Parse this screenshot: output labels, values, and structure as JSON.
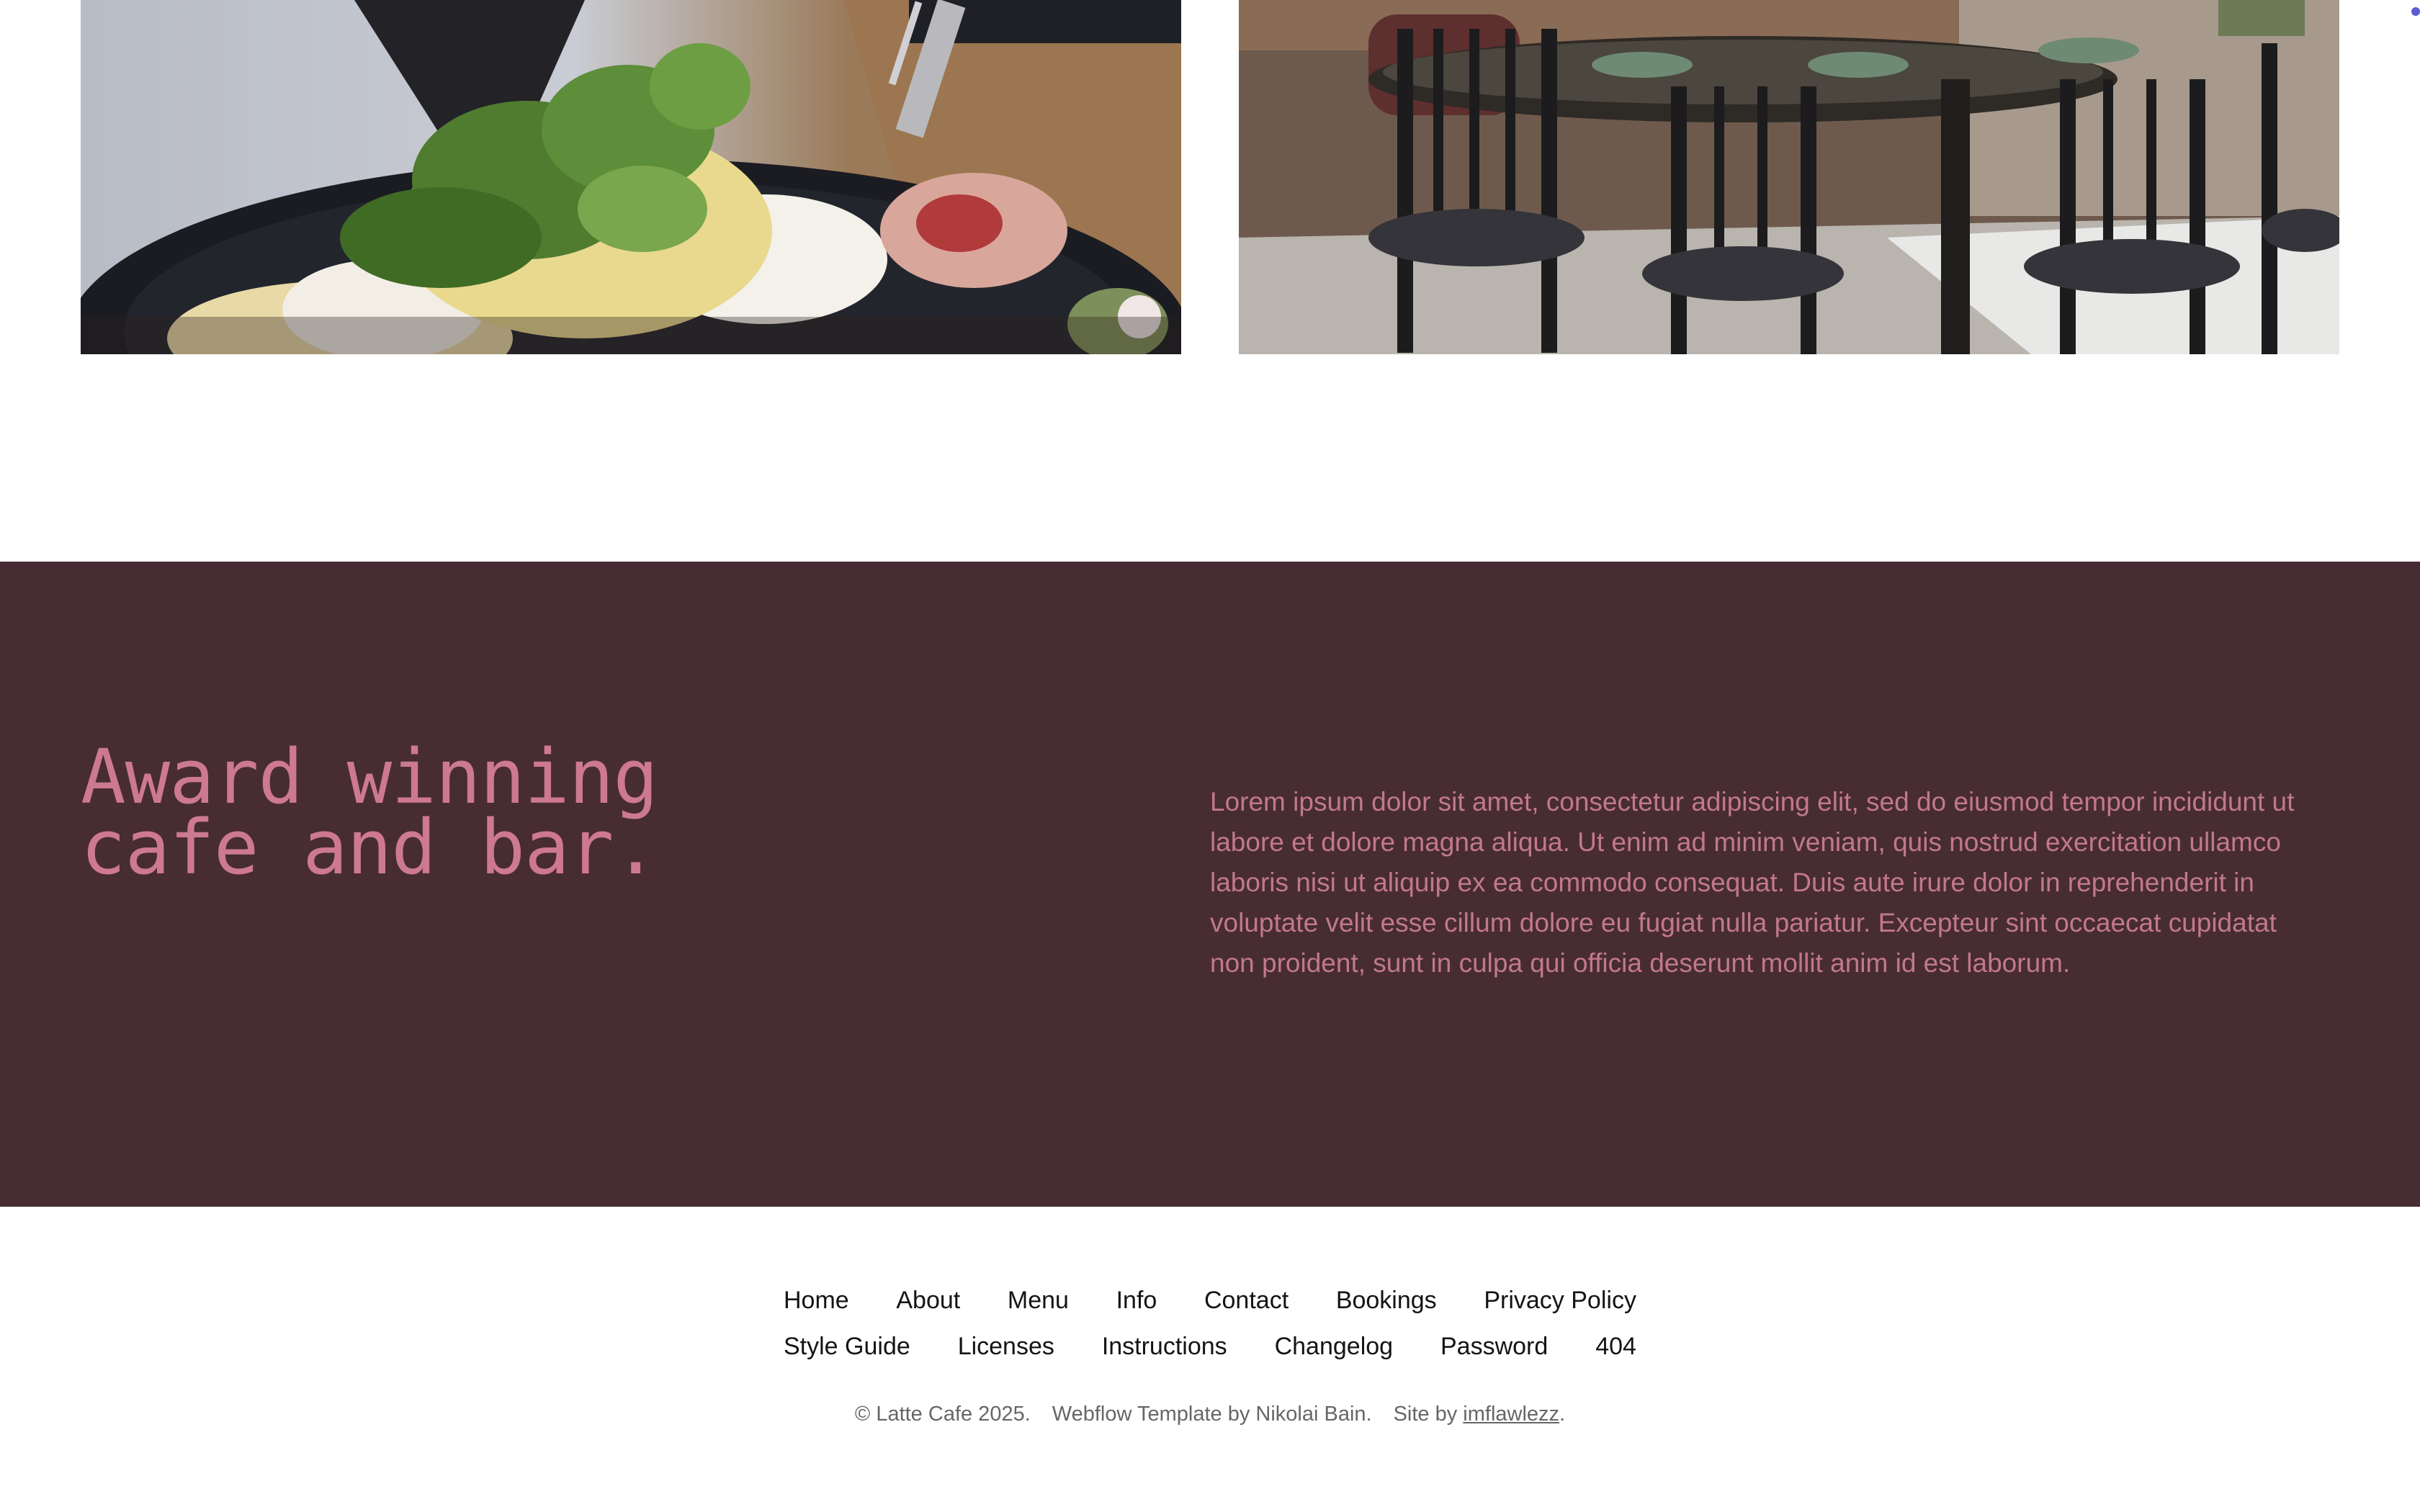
{
  "gallery": {
    "images": [
      {
        "name": "eggs-benedict-photo"
      },
      {
        "name": "dining-room-photo"
      }
    ]
  },
  "about": {
    "heading": "Award winning\ncafe and bar.",
    "body": "Lorem ipsum dolor sit amet, consectetur adipiscing elit, sed do eiusmod tempor incididunt ut labore et dolore magna aliqua. Ut enim ad minim veniam, quis nostrud exercitation ullamco laboris nisi ut aliquip ex ea commodo consequat. Duis aute irure dolor in reprehenderit in voluptate velit esse cillum dolore eu fugiat nulla pariatur. Excepteur sint occaecat cupidatat non proident, sunt in culpa qui officia deserunt mollit anim id est laborum."
  },
  "footer": {
    "nav_row_1": [
      "Home",
      "About",
      "Menu",
      "Info",
      "Contact",
      "Bookings",
      "Privacy Policy"
    ],
    "nav_row_2": [
      "Style Guide",
      "Licenses",
      "Instructions",
      "Changelog",
      "Password",
      "404"
    ],
    "copyright": "© Latte Cafe 2025.",
    "template_credit": "Webflow Template by Nikolai Bain.",
    "site_by_prefix": "Site by ",
    "site_by_link": "imflawlezz",
    "site_by_suffix": "."
  },
  "colors": {
    "band_background": "#472c33",
    "heading_pink": "#cd7990",
    "body_pink": "#c2788d",
    "link_dark": "#141414",
    "credit_gray": "#666666"
  }
}
